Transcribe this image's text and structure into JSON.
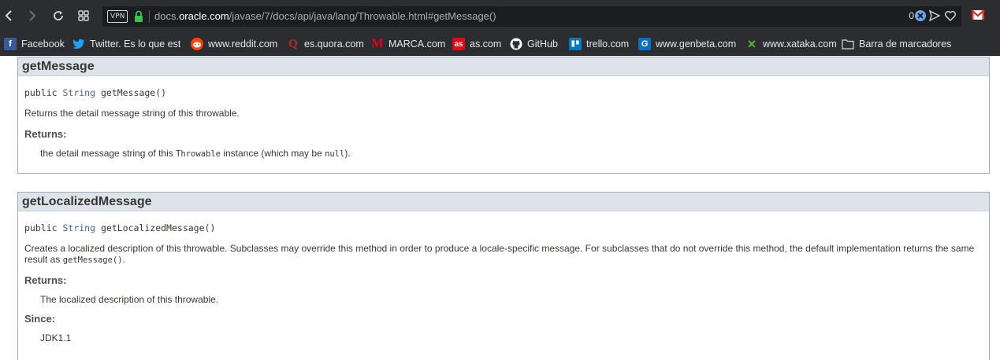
{
  "browser": {
    "url_host_prefix": "docs.",
    "url_host": "oracle.com",
    "url_path": "/javase/7/docs/api/java/lang/Throwable.html#getMessage()",
    "vpn_label": "VPN",
    "ad_block_count": "0",
    "accent_color": "#2f80ed"
  },
  "bookmarks": [
    {
      "label": "Facebook",
      "icon": "facebook-icon",
      "icon_text": "f",
      "icon_bg": "#3b5998",
      "icon_fg": "#ffffff"
    },
    {
      "label": "Twitter. Es lo que está",
      "icon": "twitter-icon",
      "icon_text": "🐦",
      "icon_bg": "transparent",
      "icon_fg": "#1da1f2"
    },
    {
      "label": "www.reddit.com",
      "icon": "reddit-icon",
      "icon_text": "●",
      "icon_bg": "#ff4500",
      "icon_fg": "#ffffff"
    },
    {
      "label": "es.quora.com",
      "icon": "quora-icon",
      "icon_text": "Q",
      "icon_bg": "transparent",
      "icon_fg": "#b92b27"
    },
    {
      "label": "MARCA.com",
      "icon": "marca-icon",
      "icon_text": "M",
      "icon_bg": "transparent",
      "icon_fg": "#e2001a"
    },
    {
      "label": "as.com",
      "icon": "as-icon",
      "icon_text": "as",
      "icon_bg": "#e30613",
      "icon_fg": "#ffffff"
    },
    {
      "label": "GitHub",
      "icon": "github-icon",
      "icon_text": "●",
      "icon_bg": "transparent",
      "icon_fg": "#ffffff"
    },
    {
      "label": "trello.com",
      "icon": "trello-icon",
      "icon_text": "▮",
      "icon_bg": "#0079bf",
      "icon_fg": "#ffffff"
    },
    {
      "label": "www.genbeta.com",
      "icon": "genbeta-icon",
      "icon_text": "G",
      "icon_bg": "#0a6fc2",
      "icon_fg": "#ffffff"
    },
    {
      "label": "www.xataka.com",
      "icon": "xataka-icon",
      "icon_text": "✕",
      "icon_bg": "transparent",
      "icon_fg": "#5cb82e"
    },
    {
      "label": "Barra de marcadores",
      "icon": "folder-icon",
      "icon_text": "",
      "icon_bg": "transparent",
      "icon_fg": "#e6e6e6"
    }
  ],
  "methods": [
    {
      "name": "getMessage",
      "signature": {
        "modifier": "public",
        "type": "String",
        "call": "getMessage()"
      },
      "description": "Returns the detail message string of this throwable.",
      "returns_label": "Returns:",
      "returns": {
        "pre": "the detail message string of this ",
        "code1": "Throwable",
        "mid": " instance (which may be ",
        "code2": "null",
        "post": ")."
      }
    },
    {
      "name": "getLocalizedMessage",
      "signature": {
        "modifier": "public",
        "type": "String",
        "call": "getLocalizedMessage()"
      },
      "description_pre": "Creates a localized description of this throwable. Subclasses may override this method in order to produce a locale-specific message. For subclasses that do not override this method, the default implementation returns the same result as ",
      "description_code": "getMessage()",
      "description_post": ".",
      "returns_label": "Returns:",
      "returns": "The localized description of this throwable.",
      "since_label": "Since:",
      "since": "JDK1.1"
    }
  ]
}
